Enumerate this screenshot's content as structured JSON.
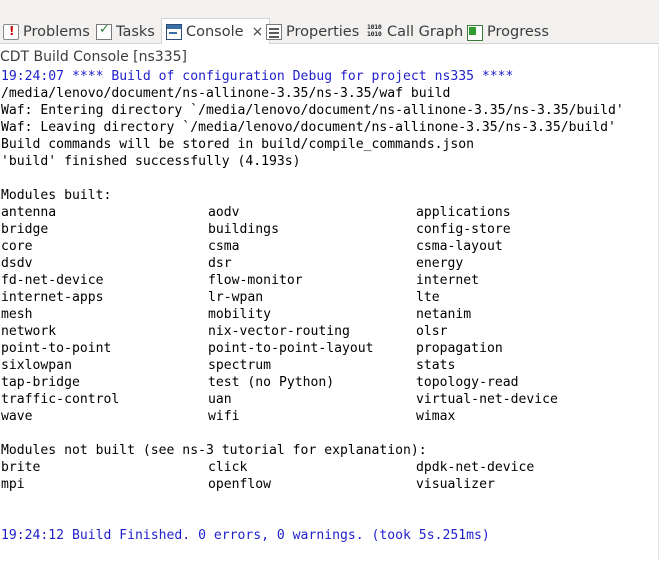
{
  "tabs": [
    {
      "label": "Problems",
      "icon": "problems-icon"
    },
    {
      "label": "Tasks",
      "icon": "tasks-icon"
    },
    {
      "label": "Console",
      "icon": "console-icon",
      "active": true,
      "close": "×"
    },
    {
      "label": "Properties",
      "icon": "properties-icon"
    },
    {
      "label": "Call Graph",
      "icon": "call-graph-icon",
      "icon_text": "1010"
    },
    {
      "label": "Progress",
      "icon": "progress-icon"
    }
  ],
  "console": {
    "title": "CDT Build Console [ns335]",
    "header_lines": [
      "19:24:07 **** Build of configuration Debug for project ns335 ****",
      "/media/lenovo/document/ns-allinone-3.35/ns-3.35/waf build",
      "Waf: Entering directory `/media/lenovo/document/ns-allinone-3.35/ns-3.35/build'",
      "Waf: Leaving directory `/media/lenovo/document/ns-allinone-3.35/ns-3.35/build'",
      "Build commands will be stored in build/compile_commands.json",
      "'build' finished successfully (4.193s)"
    ],
    "modules_built_heading": "Modules built:",
    "modules_built": [
      [
        "antenna",
        "aodv",
        "applications"
      ],
      [
        "bridge",
        "buildings",
        "config-store"
      ],
      [
        "core",
        "csma",
        "csma-layout"
      ],
      [
        "dsdv",
        "dsr",
        "energy"
      ],
      [
        "fd-net-device",
        "flow-monitor",
        "internet"
      ],
      [
        "internet-apps",
        "lr-wpan",
        "lte"
      ],
      [
        "mesh",
        "mobility",
        "netanim"
      ],
      [
        "network",
        "nix-vector-routing",
        "olsr"
      ],
      [
        "point-to-point",
        "point-to-point-layout",
        "propagation"
      ],
      [
        "sixlowpan",
        "spectrum",
        "stats"
      ],
      [
        "tap-bridge",
        "test (no Python)",
        "topology-read"
      ],
      [
        "traffic-control",
        "uan",
        "virtual-net-device"
      ],
      [
        "wave",
        "wifi",
        "wimax"
      ]
    ],
    "modules_not_built_heading": "Modules not built (see ns-3 tutorial for explanation):",
    "modules_not_built": [
      [
        "brite",
        "click",
        "dpdk-net-device"
      ],
      [
        "mpi",
        "openflow",
        "visualizer"
      ]
    ],
    "footer_line": "19:24:12 Build Finished. 0 errors, 0 warnings. (took 5s.251ms)",
    "timestamp_color": "#1f1fcc"
  }
}
